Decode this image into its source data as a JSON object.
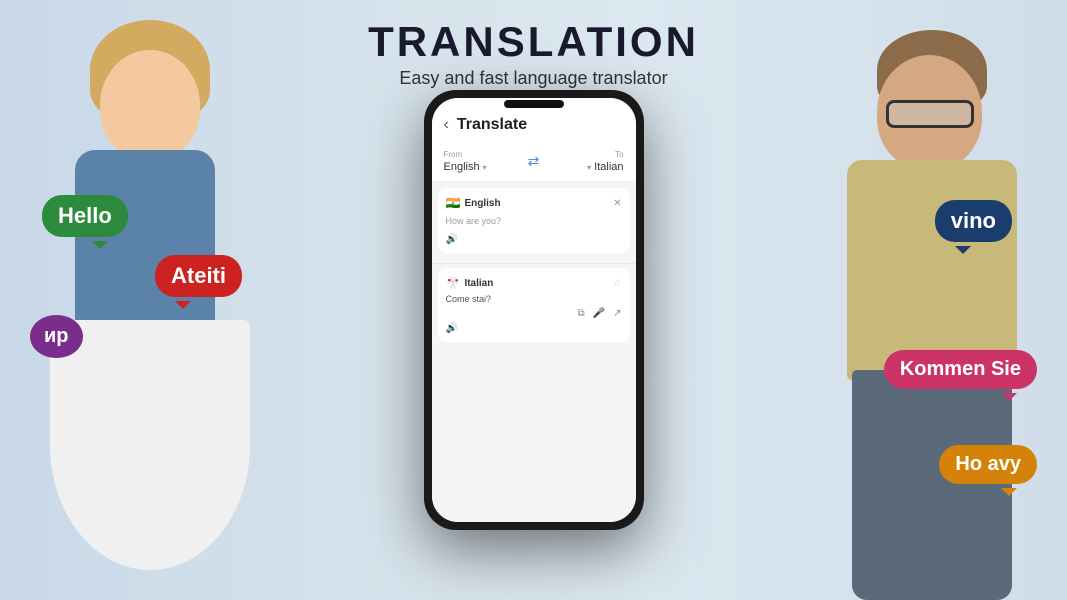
{
  "app": {
    "title": "TRANSLATION",
    "subtitle": "Easy and fast language translator"
  },
  "phone": {
    "header": {
      "back_label": "‹",
      "title": "Translate"
    },
    "language_selector": {
      "from_label": "From",
      "from_lang": "English",
      "from_arrow": "▾",
      "swap_icon": "⇄",
      "to_label": "To",
      "to_arrow": "▾",
      "to_lang": "Italian"
    },
    "input_section": {
      "flag": "🇮🇳",
      "language": "English",
      "close_icon": "✕",
      "placeholder": "How are you?",
      "volume_icon": "🔊"
    },
    "output_section": {
      "flag": "🎌",
      "language": "Italian",
      "star_icon": "☆",
      "output_text": "Come stai?",
      "copy_icon": "⧉",
      "mic_icon": "🎤",
      "share_icon": "↗",
      "volume_icon": "🔊"
    }
  },
  "bubbles": {
    "hello": "Hello",
    "ateiti": "Ateiti",
    "ir": "ир",
    "vino": "vino",
    "kommen": "Kommen Sie",
    "hoavy": "Ho avy"
  },
  "colors": {
    "bubble_green": "#2d8b3e",
    "bubble_red": "#cc2222",
    "bubble_purple": "#7b2d8b",
    "bubble_navy": "#1a4d7e",
    "bubble_pink": "#cc3366",
    "bubble_orange": "#d4820a",
    "accent_blue": "#4a90d9"
  }
}
